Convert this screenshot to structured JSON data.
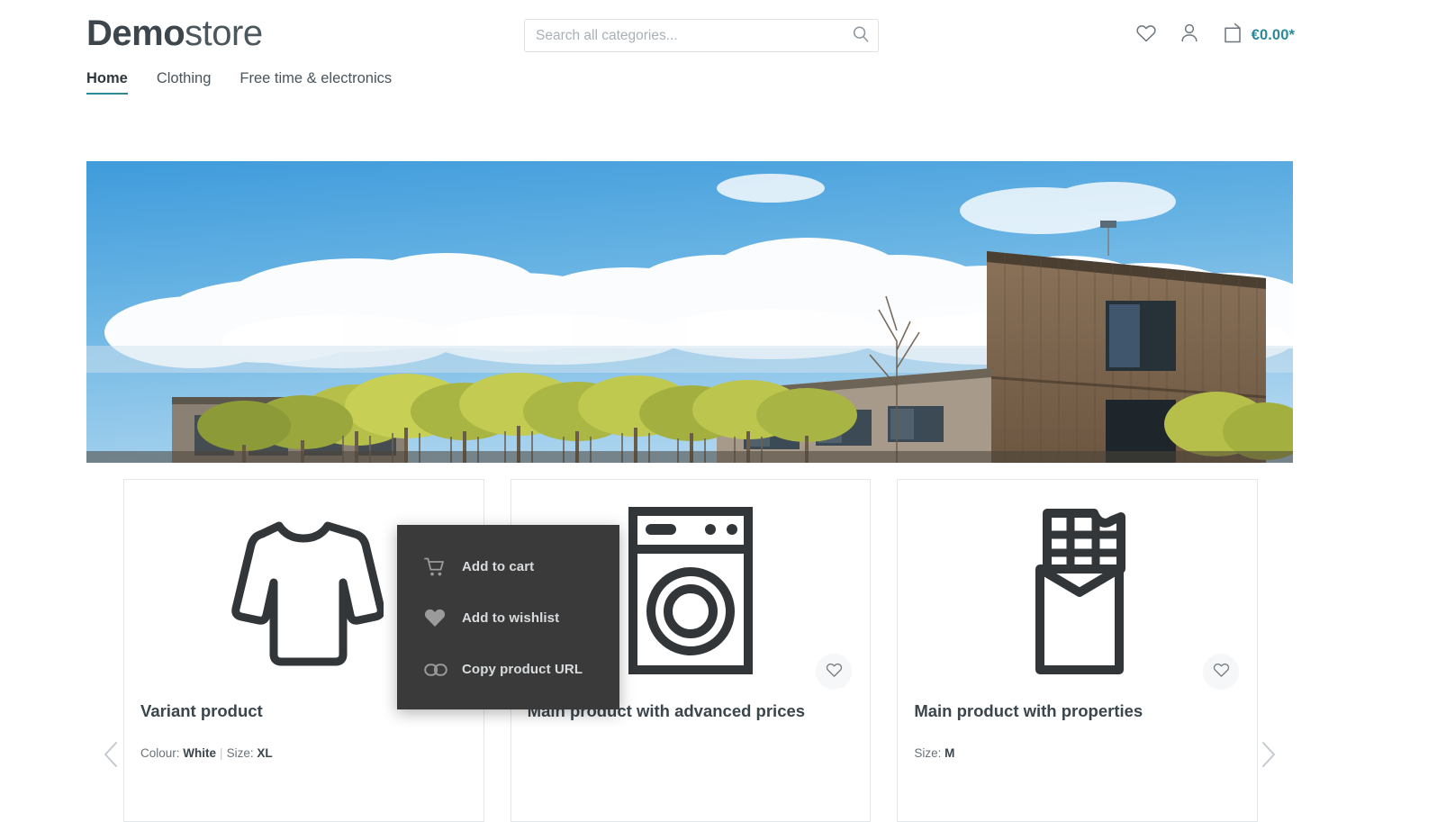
{
  "header": {
    "logo_bold": "Demo",
    "logo_light": "store",
    "search": {
      "placeholder": "Search all categories...",
      "value": "",
      "icon": "search-icon"
    },
    "actions": {
      "wishlist_icon": "heart-icon",
      "account_icon": "person-icon",
      "cart_icon": "shopping-bag-icon",
      "cart_amount": "€0.00*"
    }
  },
  "nav": {
    "items": [
      {
        "label": "Home",
        "active": true
      },
      {
        "label": "Clothing",
        "active": false
      },
      {
        "label": "Free time & electronics",
        "active": false
      }
    ]
  },
  "hero": {
    "alt": "Modern wooden office building with trees under a blue cloudy sky"
  },
  "carousel": {
    "prev_icon": "chevron-left-icon",
    "next_icon": "chevron-right-icon"
  },
  "products": [
    {
      "title": "Variant product",
      "image_icon": "sweater-icon",
      "variant_label_1": "Colour:",
      "variant_value_1": "White",
      "separator": "|",
      "variant_label_2": "Size:",
      "variant_value_2": "XL",
      "wishlist_icon": "heart-outline-icon",
      "has_wishlist_button": false
    },
    {
      "title": "Main product with advanced prices",
      "image_icon": "washing-machine-icon",
      "wishlist_icon": "heart-outline-icon",
      "has_wishlist_button": true
    },
    {
      "title": "Main product with properties",
      "image_icon": "chocolate-bar-icon",
      "variant_label_1": "Size:",
      "variant_value_1": "M",
      "wishlist_icon": "heart-outline-icon",
      "has_wishlist_button": true
    }
  ],
  "context_menu": {
    "items": [
      {
        "label": "Add to cart",
        "icon": "shopping-cart-icon"
      },
      {
        "label": "Add to wishlist",
        "icon": "heart-filled-icon"
      },
      {
        "label": "Copy product URL",
        "icon": "link-icon"
      }
    ]
  },
  "colors": {
    "accent": "#2b8999",
    "text": "#4a545b",
    "heading": "#3b454c",
    "menu_bg": "#3a3a3a",
    "menu_text": "#d8dcde",
    "border": "#e4e7ea"
  }
}
